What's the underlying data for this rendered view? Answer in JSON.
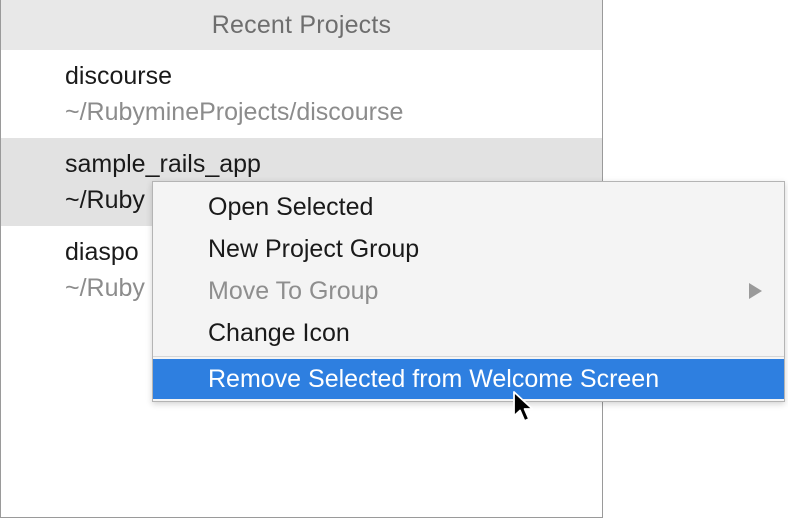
{
  "panel": {
    "title": "Recent Projects"
  },
  "projects": [
    {
      "name": "discourse",
      "path": "~/RubymineProjects/discourse",
      "selected": false
    },
    {
      "name": "sample_rails_app",
      "path": "~/Ruby",
      "selected": true
    },
    {
      "name": "diaspo",
      "path": "~/Ruby",
      "selected": false
    }
  ],
  "context_menu": {
    "items": [
      {
        "label": "Open Selected",
        "enabled": true
      },
      {
        "label": "New Project Group",
        "enabled": true
      },
      {
        "label": "Move To Group",
        "enabled": false,
        "has_submenu": true,
        "submenu_icon": "triangle-right-icon"
      },
      {
        "label": "Change Icon",
        "enabled": true
      },
      {
        "label": "Remove Selected from Welcome Screen",
        "enabled": true,
        "highlighted": true
      }
    ]
  },
  "cursor": {
    "icon": "mouse-pointer-icon"
  },
  "colors": {
    "highlight": "#2e7fe0",
    "header_bg": "#e8e8e8",
    "selected_row_bg": "#e2e2e2",
    "menu_bg": "#f4f4f4"
  }
}
